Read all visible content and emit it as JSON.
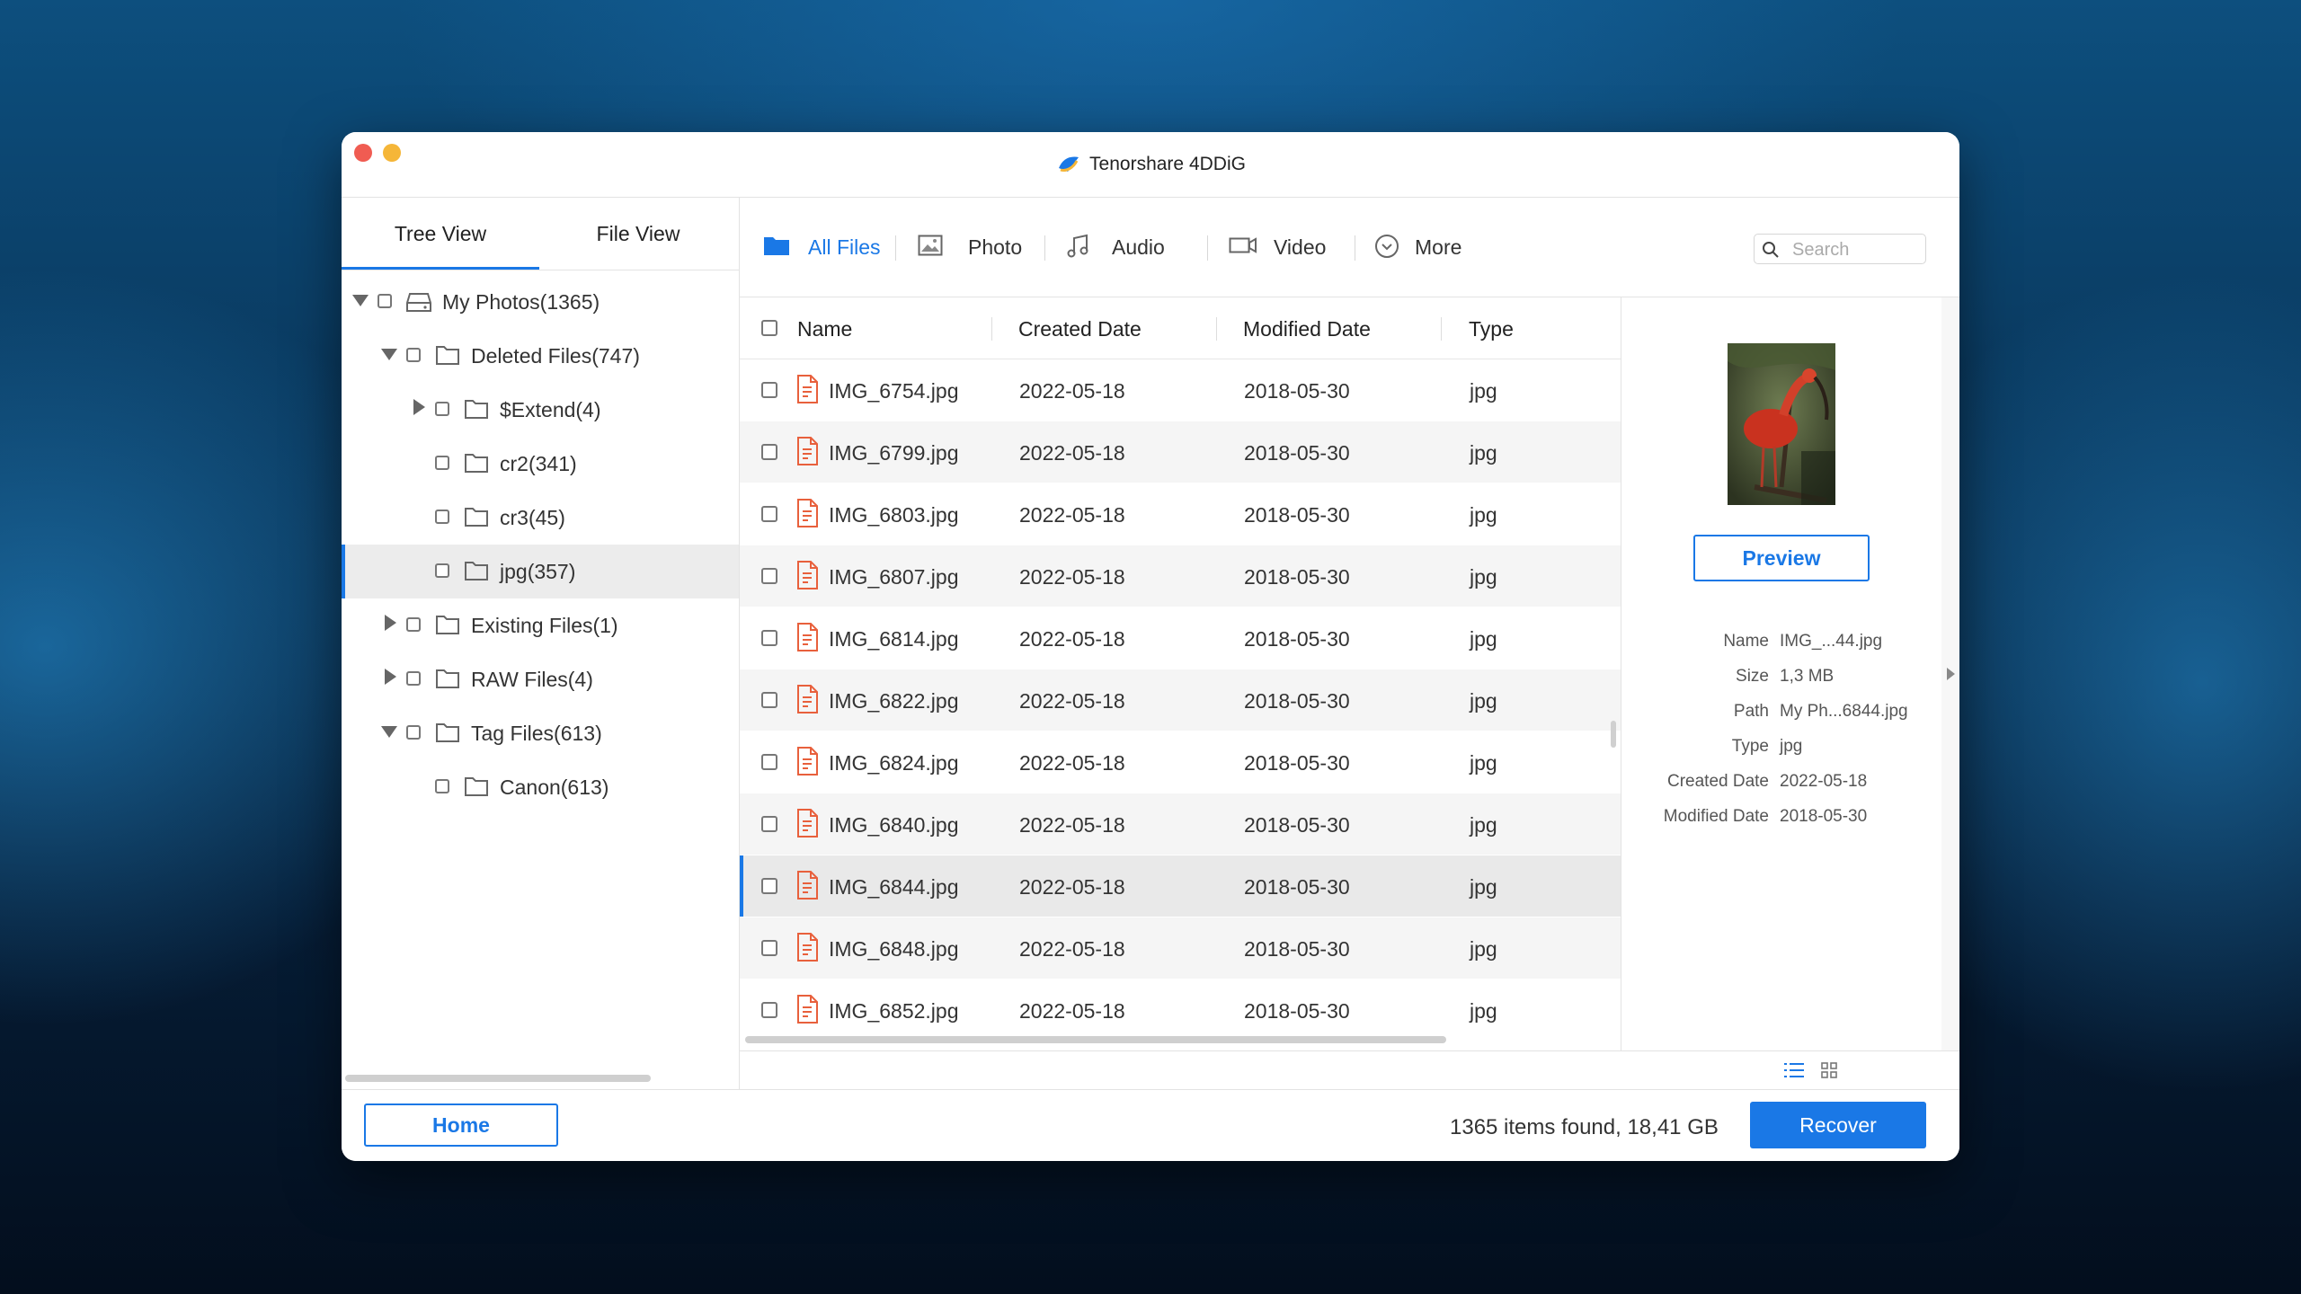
{
  "app": {
    "title": "Tenorshare 4DDiG"
  },
  "left_tabs": [
    "Tree View",
    "File View"
  ],
  "tree": [
    {
      "label": "My Photos(1365)",
      "depth": 0,
      "arrow": "down",
      "icon": "drive-icon"
    },
    {
      "label": "Deleted Files(747)",
      "depth": 1,
      "arrow": "down",
      "icon": "folder-icon"
    },
    {
      "label": "$Extend(4)",
      "depth": 2,
      "arrow": "right",
      "icon": "folder-icon"
    },
    {
      "label": "cr2(341)",
      "depth": 2,
      "arrow": "none",
      "icon": "folder-icon"
    },
    {
      "label": "cr3(45)",
      "depth": 2,
      "arrow": "none",
      "icon": "folder-icon"
    },
    {
      "label": "jpg(357)",
      "depth": 2,
      "arrow": "none",
      "icon": "folder-icon",
      "selected": true
    },
    {
      "label": "Existing Files(1)",
      "depth": 1,
      "arrow": "right",
      "icon": "folder-icon"
    },
    {
      "label": "RAW Files(4)",
      "depth": 1,
      "arrow": "right",
      "icon": "folder-icon"
    },
    {
      "label": "Tag Files(613)",
      "depth": 1,
      "arrow": "down",
      "icon": "folder-icon"
    },
    {
      "label": "Canon(613)",
      "depth": 2,
      "arrow": "none",
      "icon": "folder-icon"
    }
  ],
  "categories": [
    {
      "label": "All Files",
      "icon": "folder-icon",
      "active": true
    },
    {
      "label": "Photo",
      "icon": "photo-icon"
    },
    {
      "label": "Audio",
      "icon": "music-icon"
    },
    {
      "label": "Video",
      "icon": "video-icon"
    },
    {
      "label": "More",
      "icon": "chevron-circle-icon"
    }
  ],
  "search": {
    "placeholder": "Search"
  },
  "columns": [
    "Name",
    "Created Date",
    "Modified Date",
    "Type"
  ],
  "files": [
    {
      "name": "IMG_6754.jpg",
      "created": "2022-05-18",
      "modified": "2018-05-30",
      "type": "jpg"
    },
    {
      "name": "IMG_6799.jpg",
      "created": "2022-05-18",
      "modified": "2018-05-30",
      "type": "jpg"
    },
    {
      "name": "IMG_6803.jpg",
      "created": "2022-05-18",
      "modified": "2018-05-30",
      "type": "jpg"
    },
    {
      "name": "IMG_6807.jpg",
      "created": "2022-05-18",
      "modified": "2018-05-30",
      "type": "jpg"
    },
    {
      "name": "IMG_6814.jpg",
      "created": "2022-05-18",
      "modified": "2018-05-30",
      "type": "jpg"
    },
    {
      "name": "IMG_6822.jpg",
      "created": "2022-05-18",
      "modified": "2018-05-30",
      "type": "jpg"
    },
    {
      "name": "IMG_6824.jpg",
      "created": "2022-05-18",
      "modified": "2018-05-30",
      "type": "jpg"
    },
    {
      "name": "IMG_6840.jpg",
      "created": "2022-05-18",
      "modified": "2018-05-30",
      "type": "jpg"
    },
    {
      "name": "IMG_6844.jpg",
      "created": "2022-05-18",
      "modified": "2018-05-30",
      "type": "jpg",
      "selected": true
    },
    {
      "name": "IMG_6848.jpg",
      "created": "2022-05-18",
      "modified": "2018-05-30",
      "type": "jpg"
    },
    {
      "name": "IMG_6852.jpg",
      "created": "2022-05-18",
      "modified": "2018-05-30",
      "type": "jpg"
    }
  ],
  "preview": {
    "button": "Preview",
    "meta": [
      {
        "key": "Name",
        "value": "IMG_...44.jpg"
      },
      {
        "key": "Size",
        "value": "1,3 MB"
      },
      {
        "key": "Path",
        "value": "My Ph...6844.jpg"
      },
      {
        "key": "Type",
        "value": "jpg"
      },
      {
        "key": "Created Date",
        "value": "2022-05-18"
      },
      {
        "key": "Modified Date",
        "value": "2018-05-30"
      }
    ]
  },
  "bottom": {
    "home": "Home",
    "status": "1365 items found, 18,41 GB",
    "recover": "Recover"
  },
  "colors": {
    "accent": "#1a78e6",
    "file_icon": "#e8603c"
  }
}
